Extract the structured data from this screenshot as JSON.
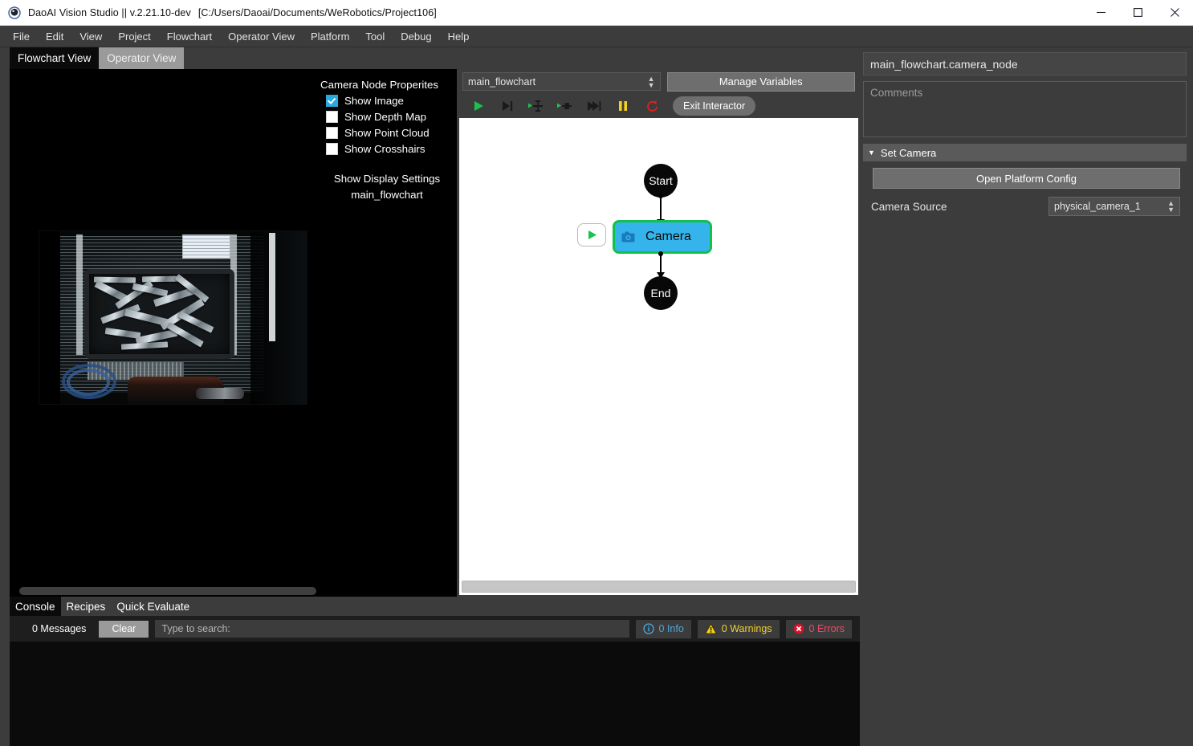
{
  "window": {
    "title": "DaoAI Vision Studio || v.2.21.10-dev",
    "project_path": "[C:/Users/Daoai/Documents/WeRobotics/Project106]",
    "minimize": "—",
    "maximize": "☐",
    "close": "✕"
  },
  "menu": {
    "items": [
      "File",
      "Edit",
      "View",
      "Project",
      "Flowchart",
      "Operator View",
      "Platform",
      "Tool",
      "Debug",
      "Help"
    ]
  },
  "view_tabs": [
    {
      "label": "Flowchart View",
      "active": true
    },
    {
      "label": "Operator View",
      "active": false
    }
  ],
  "viewport": {
    "properties_title": "Camera Node Properites",
    "checkboxes": [
      {
        "label": "Show Image",
        "checked": true
      },
      {
        "label": "Show Depth Map",
        "checked": false
      },
      {
        "label": "Show Point Cloud",
        "checked": false
      },
      {
        "label": "Show Crosshairs",
        "checked": false
      }
    ],
    "display_settings_label": "Show Display Settings",
    "display_settings_value": "main_flowchart"
  },
  "flowchart": {
    "selector_value": "main_flowchart",
    "manage_variables_label": "Manage Variables",
    "toolbar": [
      {
        "name": "run-icon",
        "title": "Run"
      },
      {
        "name": "step-over-icon",
        "title": "Step"
      },
      {
        "name": "run-to-node-icon",
        "title": "Run To Node"
      },
      {
        "name": "run-from-node-icon",
        "title": "Run From Node"
      },
      {
        "name": "fast-forward-icon",
        "title": "Continue"
      },
      {
        "name": "pause-icon",
        "title": "Pause"
      },
      {
        "name": "reload-icon",
        "title": "Reload"
      }
    ],
    "exit_interactor_label": "Exit Interactor",
    "nodes": [
      {
        "id": "start",
        "label": "Start",
        "type": "terminal"
      },
      {
        "id": "camera",
        "label": "Camera",
        "type": "task",
        "icon": "camera-icon",
        "selected": true
      },
      {
        "id": "end",
        "label": "End",
        "type": "terminal"
      }
    ],
    "run_node_label": "▶"
  },
  "console": {
    "tabs": [
      {
        "label": "Console",
        "active": true
      },
      {
        "label": "Recipes",
        "active": false
      },
      {
        "label": "Quick Evaluate",
        "active": false
      }
    ],
    "message_count": "0 Messages",
    "clear_label": "Clear",
    "search_placeholder": "Type to search:",
    "search_value": "",
    "status": [
      {
        "label": "0 Info",
        "kind": "info"
      },
      {
        "label": "0 Warnings",
        "kind": "warn"
      },
      {
        "label": "0 Errors",
        "kind": "error"
      }
    ]
  },
  "inspector": {
    "title": "main_flowchart.camera_node",
    "comments_placeholder": "Comments",
    "comments_value": "",
    "section_label": "Set Camera",
    "section_expanded": true,
    "open_platform_config_label": "Open Platform Config",
    "camera_source_label": "Camera Source",
    "camera_source_value": "physical_camera_1"
  },
  "colors": {
    "accent_blue": "#35b4ec",
    "node_border_green": "#11c14a",
    "run_green": "#19c24f",
    "pause_yellow": "#f5d020",
    "reload_red": "#e02020",
    "info_blue": "#4aa8dd",
    "warn_yellow": "#f0d32a",
    "error_red": "#ef4b66",
    "panel_bg": "#3c3c3c",
    "canvas_bg": "#ffffff"
  }
}
